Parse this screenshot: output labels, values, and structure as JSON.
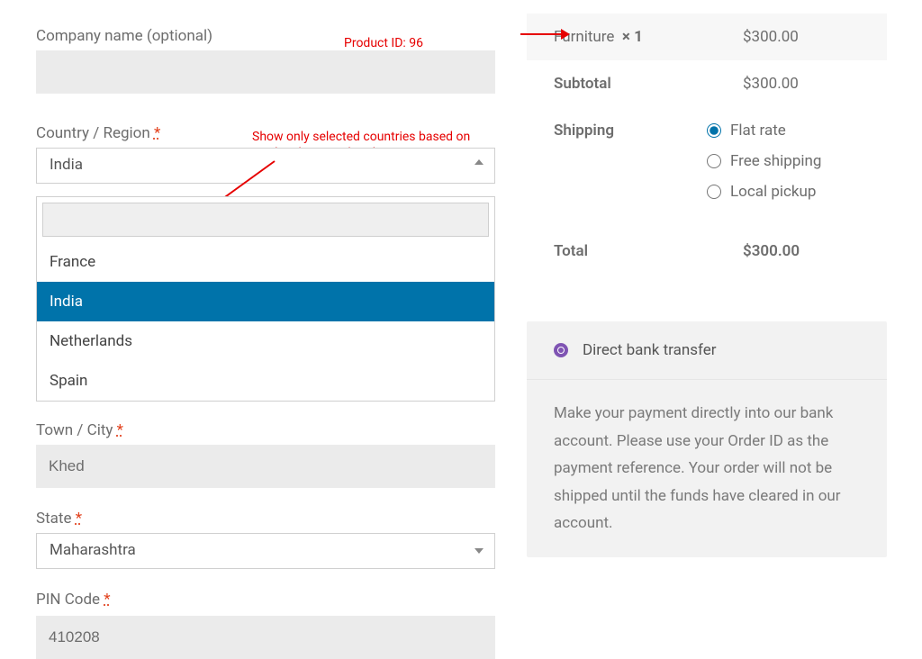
{
  "form": {
    "company_label": "Company name (optional)",
    "company_value": "",
    "country_label": "Country / Region",
    "country_selected": "India",
    "country_options": [
      "France",
      "India",
      "Netherlands",
      "Spain"
    ],
    "town_label": "Town / City",
    "town_value": "Khed",
    "state_label": "State",
    "state_value": "Maharashtra",
    "pin_label": "PIN Code",
    "pin_value": "410208",
    "required_mark": "*"
  },
  "annotations": {
    "product_id": "Product ID: 96",
    "country_note": "Show only selected countries based on product being ordered."
  },
  "order": {
    "product_name": "Furniture",
    "product_qty": "× 1",
    "product_price": "$300.00",
    "subtotal_label": "Subtotal",
    "subtotal_value": "$300.00",
    "shipping_label": "Shipping",
    "shipping_options": [
      {
        "label": "Flat rate",
        "selected": true
      },
      {
        "label": "Free shipping",
        "selected": false
      },
      {
        "label": "Local pickup",
        "selected": false
      }
    ],
    "total_label": "Total",
    "total_value": "$300.00"
  },
  "payment": {
    "method_label": "Direct bank transfer",
    "description": "Make your payment directly into our bank account. Please use your Order ID as the payment reference. Your order will not be shipped until the funds have cleared in our account."
  }
}
